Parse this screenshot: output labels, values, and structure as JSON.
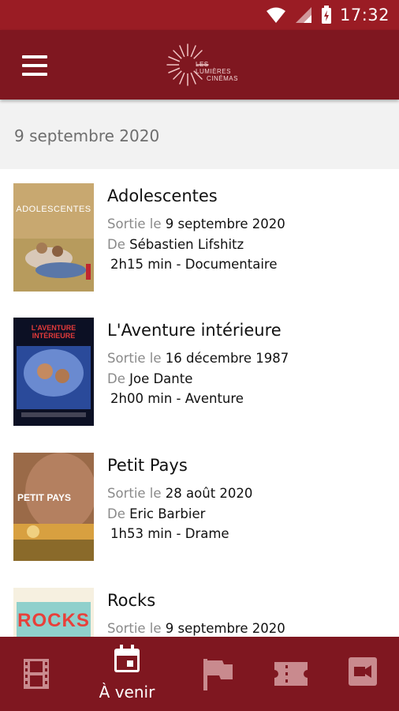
{
  "status_bar": {
    "time": "17:32"
  },
  "app_bar": {
    "logo_line1": "LES LUMIÈRES",
    "logo_line2": "CINÉMAS"
  },
  "date_header": "9 septembre 2020",
  "labels": {
    "release_prefix": "Sortie le",
    "director_prefix": "De"
  },
  "movies": [
    {
      "title": "Adolescentes",
      "release_date": "9 septembre 2020",
      "director": "Sébastien Lifshitz",
      "info": "2h15 min - Documentaire",
      "poster_text": "ADOLESCENTES"
    },
    {
      "title": "L'Aventure intérieure",
      "release_date": "16 décembre 1987",
      "director": "Joe Dante",
      "info": "2h00 min - Aventure",
      "poster_text": "L'AVENTURE INTÉRIEURE"
    },
    {
      "title": "Petit Pays",
      "release_date": "28 août 2020",
      "director": "Eric Barbier",
      "info": "1h53 min - Drame",
      "poster_text": "PETIT PAYS"
    },
    {
      "title": "Rocks",
      "release_date": "9 septembre 2020",
      "director": "",
      "info": "",
      "poster_text": "ROCKS"
    }
  ],
  "bottom_nav": {
    "items": [
      {
        "icon": "film-icon",
        "label": ""
      },
      {
        "icon": "calendar-icon",
        "label": "À venir",
        "active": true
      },
      {
        "icon": "flag-icon",
        "label": ""
      },
      {
        "icon": "ticket-icon",
        "label": ""
      },
      {
        "icon": "video-call-icon",
        "label": ""
      }
    ]
  },
  "colors": {
    "primary": "#7f1720",
    "status_bar": "#9a1c24",
    "header_bg": "#f2f2f2"
  }
}
